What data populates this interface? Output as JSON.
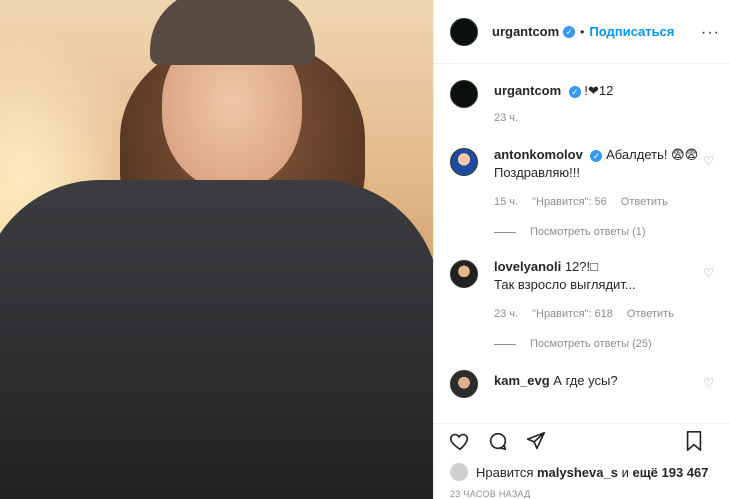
{
  "header": {
    "username": "urgantcom",
    "follow_label": "Подписаться",
    "more_label": "···"
  },
  "caption": {
    "username": "urgantcom",
    "text": "!❤︎12",
    "time": "23 ч."
  },
  "comments": [
    {
      "username": "antonkomolov",
      "verified": true,
      "line1": "Абалдеть! 😨😨",
      "line2": "Поздравляю!!!",
      "time": "15 ч.",
      "likes": "\"Нравится\": 56",
      "reply": "Ответить",
      "replies": "Посмотреть ответы (1)"
    },
    {
      "username": "lovelyanoli",
      "verified": false,
      "line1": "12?!□",
      "line2": "Так взросло выглядит...",
      "time": "23 ч.",
      "likes": "\"Нравится\": 618",
      "reply": "Ответить",
      "replies": "Посмотреть ответы (25)"
    },
    {
      "username": "kam_evg",
      "verified": false,
      "line1": "А где усы?"
    }
  ],
  "likes_line": {
    "prefix": "Нравится",
    "user": "malysheva_s",
    "middle": "и",
    "count": "ещё 193 467"
  },
  "timestamp": "23 ЧАСОВ НАЗАД",
  "icons": [
    "heart-icon",
    "comment-icon",
    "share-icon",
    "bookmark-icon"
  ],
  "colors": {
    "accent": "#0095f6",
    "verified": "#3897f0",
    "muted": "#8e8e8e"
  }
}
